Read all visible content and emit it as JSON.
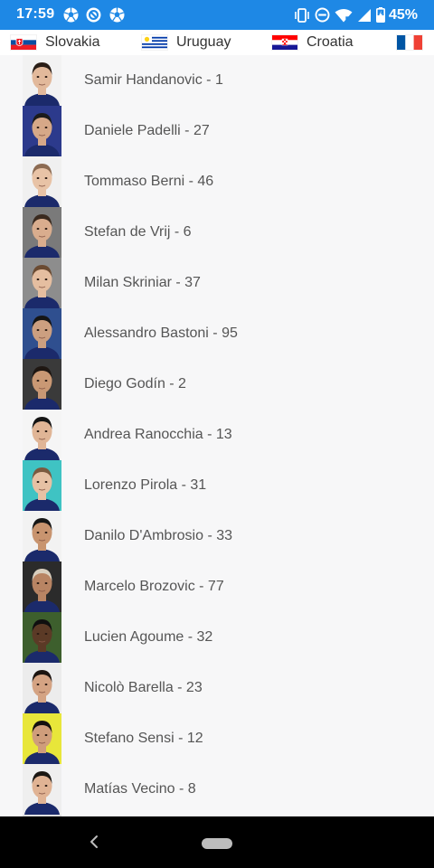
{
  "status_bar": {
    "time": "17:59",
    "battery": "45%",
    "notification_icons": [
      "soccer-ball-icon",
      "rotate-app-icon",
      "soccer-ball-icon"
    ],
    "system_icons": [
      "vibrate-icon",
      "do-not-disturb-icon",
      "wifi-icon",
      "signal-icon",
      "battery-charging-icon"
    ]
  },
  "tabs": [
    {
      "label": "Slovakia",
      "flag": "slovakia-flag"
    },
    {
      "label": "Uruguay",
      "flag": "uruguay-flag"
    },
    {
      "label": "Croatia",
      "flag": "croatia-flag"
    },
    {
      "label": "",
      "flag": "france-flag"
    }
  ],
  "players": [
    {
      "name": "Samir Handanovic - 1",
      "bg": "#f2f2f2"
    },
    {
      "name": "Daniele Padelli - 27",
      "bg": "#2c3a8c"
    },
    {
      "name": "Tommaso Berni - 46",
      "bg": "#f0f0f0"
    },
    {
      "name": "Stefan de Vrij - 6",
      "bg": "#7a7a7a"
    },
    {
      "name": "Milan Skriniar - 37",
      "bg": "#8d8d8d"
    },
    {
      "name": "Alessandro Bastoni - 95",
      "bg": "#2f4f8f"
    },
    {
      "name": "Diego Godín - 2",
      "bg": "#3a3a3a"
    },
    {
      "name": "Andrea Ranocchia - 13",
      "bg": "#f5f5f5"
    },
    {
      "name": "Lorenzo Pirola - 31",
      "bg": "#3fc3c3"
    },
    {
      "name": "Danilo D'Ambrosio - 33",
      "bg": "#f2f2f2"
    },
    {
      "name": "Marcelo Brozovic - 77",
      "bg": "#2b2b2b"
    },
    {
      "name": "Lucien Agoume - 32",
      "bg": "#3d5f2d"
    },
    {
      "name": "Nicolò Barella - 23",
      "bg": "#ececec"
    },
    {
      "name": "Stefano Sensi - 12",
      "bg": "#e8e63a"
    },
    {
      "name": "Matías Vecino - 8",
      "bg": "#efefef"
    },
    {
      "name": "",
      "bg": "#e0e0e0"
    }
  ],
  "colors": {
    "status_bar": "#1e88e5",
    "background": "#f7f7f8",
    "text": "#555555"
  }
}
